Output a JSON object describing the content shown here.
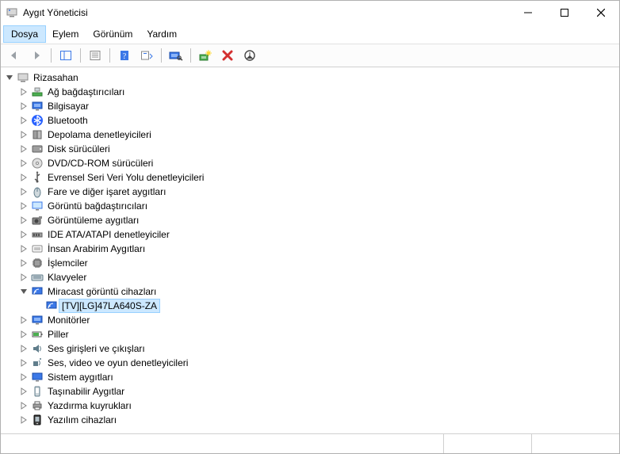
{
  "title": "Aygıt Yöneticisi",
  "menu": {
    "file": "Dosya",
    "action": "Eylem",
    "view": "Görünüm",
    "help": "Yardım"
  },
  "tree": {
    "root": "Rizasahan",
    "items": [
      "Ağ bağdaştırıcıları",
      "Bilgisayar",
      "Bluetooth",
      "Depolama denetleyicileri",
      "Disk sürücüleri",
      "DVD/CD-ROM sürücüleri",
      "Evrensel Seri Veri Yolu denetleyicileri",
      "Fare ve diğer işaret aygıtları",
      "Görüntü bağdaştırıcıları",
      "Görüntüleme aygıtları",
      "IDE ATA/ATAPI denetleyiciler",
      "İnsan Arabirim Aygıtları",
      "İşlemciler",
      "Klavyeler",
      "Miracast görüntü cihazları",
      "Monitörler",
      "Piller",
      "Ses girişleri ve çıkışları",
      "Ses, video ve oyun denetleyicileri",
      "Sistem aygıtları",
      "Taşınabilir Aygıtlar",
      "Yazdırma kuyrukları",
      "Yazılım cihazları"
    ],
    "miracast_child": "[TV][LG]47LA640S-ZA"
  }
}
